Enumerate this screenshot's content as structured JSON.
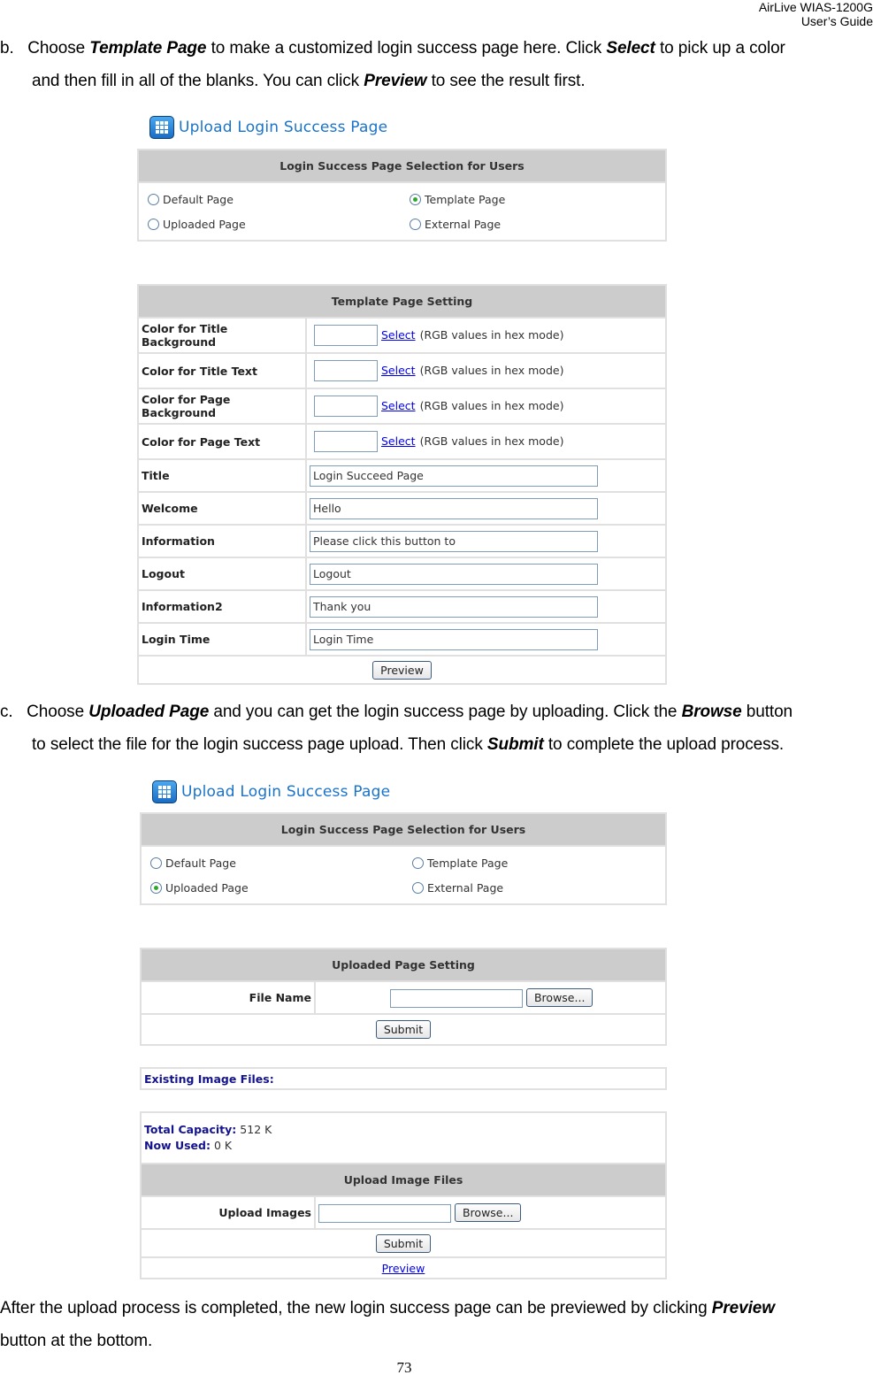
{
  "header": {
    "line1": "AirLive  WIAS-1200G",
    "line2": "User’s  Guide"
  },
  "para_b": {
    "marker": "b.",
    "t1": "Choose ",
    "b1": "Template Page",
    "t2": " to make a customized login success page here. Click ",
    "b2": "Select",
    "t3": " to pick up a color",
    "line2_t1": "and then fill in all of the blanks. You can click ",
    "line2_b1": "Preview",
    "line2_t2": " to see the result first."
  },
  "para_c": {
    "marker": "c.",
    "t1": "Choose ",
    "b1": "Uploaded Page",
    "t2": " and you can get the login success page by uploading. Click the ",
    "b2": "Browse",
    "t3": " button",
    "line2_t1": "to select the file for the login success page upload. Then click ",
    "line2_b1": "Submit",
    "line2_t2": " to complete the upload process."
  },
  "para_after": {
    "t1": "After the upload process is completed, the new login success page can be previewed by clicking ",
    "b1": "Preview",
    "line2": "button at the bottom."
  },
  "page_number": "73",
  "shot1": {
    "title": "Upload Login Success Page",
    "selection_header": "Login Success Page Selection for Users",
    "options": [
      {
        "label": "Default Page",
        "selected": false
      },
      {
        "label": "Template Page",
        "selected": true
      },
      {
        "label": "Uploaded Page",
        "selected": false
      },
      {
        "label": "External Page",
        "selected": false
      }
    ],
    "setting_header": "Template Page Setting",
    "color_rows": [
      {
        "label": "Color for Title Background",
        "value": "",
        "link": "Select",
        "hint": "(RGB values in hex mode)"
      },
      {
        "label": "Color for Title Text",
        "value": "",
        "link": "Select",
        "hint": "(RGB values in hex mode)"
      },
      {
        "label": "Color for Page Background",
        "value": "",
        "link": "Select",
        "hint": "(RGB values in hex mode)"
      },
      {
        "label": "Color for Page Text",
        "value": "",
        "link": "Select",
        "hint": "(RGB values in hex mode)"
      }
    ],
    "text_rows": [
      {
        "label": "Title",
        "value": "Login Succeed Page"
      },
      {
        "label": "Welcome",
        "value": "Hello"
      },
      {
        "label": "Information",
        "value": "Please click this button to"
      },
      {
        "label": "Logout",
        "value": "Logout"
      },
      {
        "label": "Information2",
        "value": "Thank you"
      },
      {
        "label": "Login Time",
        "value": "Login Time"
      }
    ],
    "preview_button": "Preview"
  },
  "shot2": {
    "title": "Upload Login Success Page",
    "selection_header": "Login Success Page Selection for Users",
    "options": [
      {
        "label": "Default Page",
        "selected": false
      },
      {
        "label": "Template Page",
        "selected": false
      },
      {
        "label": "Uploaded Page",
        "selected": true
      },
      {
        "label": "External Page",
        "selected": false
      }
    ],
    "uploaded_header": "Uploaded Page Setting",
    "file_name_label": "File Name",
    "file_name_value": "",
    "browse_button": "Browse...",
    "submit_button": "Submit",
    "existing_files_label": "Existing Image Files:",
    "total_capacity_label": "Total Capacity:",
    "total_capacity_value": "512 K",
    "now_used_label": "Now Used:",
    "now_used_value": "0 K",
    "upload_images_header": "Upload Image Files",
    "upload_images_label": "Upload Images",
    "upload_images_value": "",
    "browse_button2": "Browse...",
    "submit_button2": "Submit",
    "preview_link": "Preview"
  }
}
